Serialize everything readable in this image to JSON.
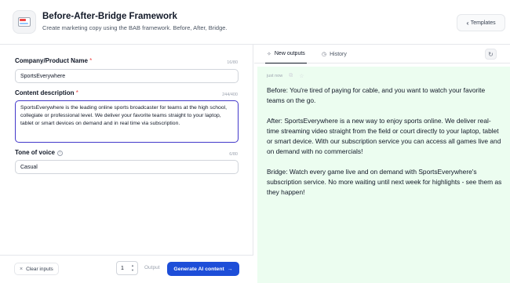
{
  "header": {
    "title": "Before-After-Bridge Framework",
    "subtitle": "Create marketing copy using the BAB framework. Before, After, Bridge.",
    "templates_label": "Templates",
    "templates_icon": "chevrons-left-icon",
    "app_icon": "browser-window-icon"
  },
  "form": {
    "company": {
      "label": "Company/Product Name",
      "required_mark": "*",
      "counter": "16/80",
      "value": "SportsEverywhere"
    },
    "description": {
      "label": "Content description",
      "required_mark": "*",
      "counter": "244/400",
      "value": "SportsEverywhere is the leading online sports broadcaster for teams at the high school, collegiate or professional level. We deliver your favorite teams straight to your laptop, tablet or smart devices on demand and in real time via subscription."
    },
    "tone": {
      "label": "Tone of voice",
      "info_icon": "i",
      "counter": "6/80",
      "value": "Casual"
    }
  },
  "footer": {
    "clear_label": "Clear inputs",
    "clear_icon": "×",
    "output_count": "1",
    "output_label": "Output",
    "generate_label": "Generate AI content",
    "generate_icon": "→",
    "accent_color": "#1d4ed8"
  },
  "tabs": {
    "new_outputs": "New outputs",
    "history": "History"
  },
  "output": {
    "timestamp": "just now",
    "paragraphs": [
      "Before: You're tired of paying for cable, and you want to watch your favorite teams on the go.",
      "After: SportsEverywhere is a new way to enjoy sports online. We deliver real-time streaming video straight from the field or court directly to your laptop, tablet or smart device. With our subscription service you can access all games live and on demand with no commercials!",
      "Bridge: Watch every game live and on demand with SportsEverywhere's subscription service. No more waiting until next week for highlights - see them as they happen!"
    ],
    "panel_color": "#ecfdf0"
  }
}
